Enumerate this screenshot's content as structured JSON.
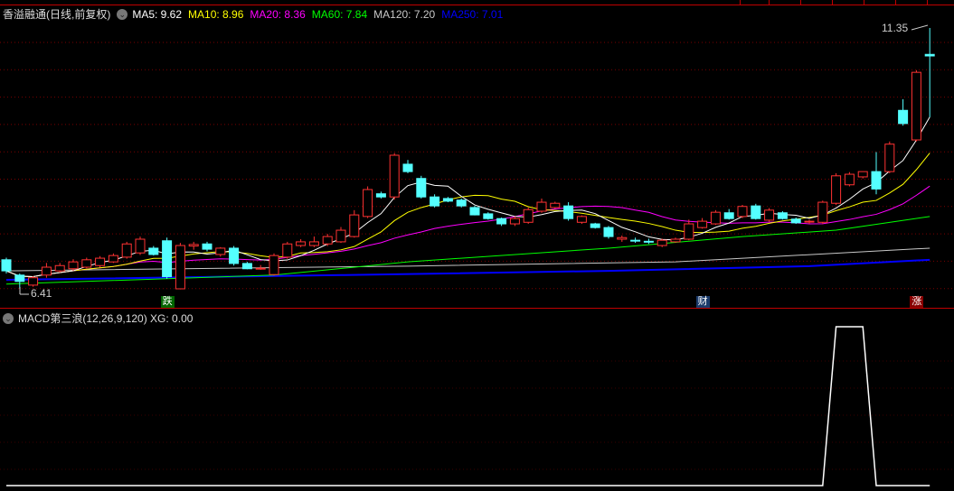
{
  "header": {
    "title": "香溢融通(日线,前复权)",
    "ma": [
      {
        "label": "MA5: 9.62",
        "color": "#ffffff"
      },
      {
        "label": "MA10: 8.96",
        "color": "#ffff00"
      },
      {
        "label": "MA20: 8.36",
        "color": "#ff00ff"
      },
      {
        "label": "MA60: 7.84",
        "color": "#00ff00"
      },
      {
        "label": "MA120: 7.20",
        "color": "#c8c8c8"
      },
      {
        "label": "MA250: 7.01",
        "color": "#0000ff"
      }
    ]
  },
  "annotations": {
    "high_label": "11.35",
    "low_label": "6.41",
    "high_price": 11.35,
    "low_price": 6.41
  },
  "markers": [
    {
      "text": "跌",
      "index": 12,
      "bg": "#006600"
    },
    {
      "text": "财",
      "index": 52,
      "bg": "#1a3a6a"
    },
    {
      "text": "涨",
      "index": 68,
      "bg": "#880000"
    }
  ],
  "indicator": {
    "title": "MACD第三浪(12,26,9,120) XG: 0.00"
  },
  "colors": {
    "up": "#ff3232",
    "down": "#54ffff",
    "grid": "#7a0000"
  },
  "chart_data": {
    "type": "candlestick",
    "ohlc": [
      [
        6.96,
        7.0,
        6.7,
        6.75
      ],
      [
        6.67,
        6.7,
        6.41,
        6.55
      ],
      [
        6.48,
        6.65,
        6.45,
        6.62
      ],
      [
        6.67,
        6.9,
        6.62,
        6.82
      ],
      [
        6.75,
        6.9,
        6.72,
        6.85
      ],
      [
        6.79,
        6.97,
        6.75,
        6.92
      ],
      [
        6.82,
        7.0,
        6.8,
        6.96
      ],
      [
        6.85,
        7.03,
        6.82,
        6.99
      ],
      [
        6.92,
        7.08,
        6.9,
        7.04
      ],
      [
        7.01,
        7.3,
        6.98,
        7.26
      ],
      [
        7.09,
        7.4,
        7.05,
        7.35
      ],
      [
        7.18,
        7.22,
        7.04,
        7.06
      ],
      [
        7.32,
        7.38,
        6.6,
        6.64
      ],
      [
        6.41,
        7.28,
        6.4,
        7.23
      ],
      [
        7.22,
        7.3,
        7.15,
        7.25
      ],
      [
        7.26,
        7.3,
        7.12,
        7.16
      ],
      [
        7.06,
        7.2,
        7.02,
        7.18
      ],
      [
        7.18,
        7.22,
        6.85,
        6.89
      ],
      [
        6.89,
        6.92,
        6.78,
        6.79
      ],
      [
        6.8,
        6.86,
        6.77,
        6.8
      ],
      [
        6.68,
        7.08,
        6.66,
        7.04
      ],
      [
        7.01,
        7.3,
        6.98,
        7.26
      ],
      [
        7.23,
        7.35,
        7.2,
        7.3
      ],
      [
        7.23,
        7.4,
        7.2,
        7.3
      ],
      [
        7.26,
        7.45,
        7.22,
        7.4
      ],
      [
        7.3,
        7.58,
        7.28,
        7.52
      ],
      [
        7.4,
        7.9,
        7.38,
        7.81
      ],
      [
        7.78,
        8.35,
        7.75,
        8.29
      ],
      [
        8.21,
        8.25,
        8.12,
        8.15
      ],
      [
        8.15,
        8.98,
        8.1,
        8.94
      ],
      [
        8.77,
        8.85,
        8.6,
        8.63
      ],
      [
        8.5,
        8.55,
        8.12,
        8.15
      ],
      [
        8.15,
        8.2,
        7.95,
        7.98
      ],
      [
        8.12,
        8.15,
        8.05,
        8.07
      ],
      [
        8.09,
        8.12,
        7.95,
        7.98
      ],
      [
        7.95,
        7.98,
        7.8,
        7.81
      ],
      [
        7.83,
        7.86,
        7.72,
        7.74
      ],
      [
        7.74,
        7.76,
        7.6,
        7.64
      ],
      [
        7.64,
        7.78,
        7.6,
        7.74
      ],
      [
        7.67,
        7.95,
        7.64,
        7.91
      ],
      [
        7.88,
        8.12,
        7.85,
        8.05
      ],
      [
        7.95,
        8.06,
        7.93,
        8.03
      ],
      [
        7.98,
        8.05,
        7.7,
        7.74
      ],
      [
        7.67,
        7.8,
        7.64,
        7.78
      ],
      [
        7.64,
        7.66,
        7.55,
        7.57
      ],
      [
        7.57,
        7.6,
        7.36,
        7.4
      ],
      [
        7.35,
        7.42,
        7.3,
        7.38
      ],
      [
        7.33,
        7.38,
        7.28,
        7.32
      ],
      [
        7.31,
        7.36,
        7.26,
        7.3
      ],
      [
        7.23,
        7.36,
        7.2,
        7.33
      ],
      [
        7.3,
        7.38,
        7.28,
        7.35
      ],
      [
        7.35,
        7.72,
        7.33,
        7.64
      ],
      [
        7.57,
        7.75,
        7.55,
        7.69
      ],
      [
        7.64,
        7.9,
        7.62,
        7.86
      ],
      [
        7.85,
        7.92,
        7.72,
        7.74
      ],
      [
        7.78,
        8.0,
        7.75,
        7.97
      ],
      [
        7.98,
        8.02,
        7.72,
        7.74
      ],
      [
        7.71,
        7.94,
        7.68,
        7.9
      ],
      [
        7.85,
        7.88,
        7.72,
        7.74
      ],
      [
        7.73,
        7.76,
        7.64,
        7.66
      ],
      [
        7.68,
        7.72,
        7.64,
        7.69
      ],
      [
        7.67,
        8.08,
        7.64,
        8.05
      ],
      [
        8.03,
        8.6,
        8.0,
        8.55
      ],
      [
        8.38,
        8.62,
        8.35,
        8.58
      ],
      [
        8.53,
        8.62,
        8.5,
        8.63
      ],
      [
        8.63,
        9.0,
        8.2,
        8.3
      ],
      [
        8.63,
        9.2,
        8.6,
        9.15
      ],
      [
        9.79,
        10.0,
        9.5,
        9.54
      ],
      [
        9.23,
        10.55,
        9.2,
        10.51
      ],
      [
        10.85,
        11.35,
        9.66,
        10.82
      ]
    ],
    "ma60": [
      [
        0,
        6.5
      ],
      [
        20,
        6.67
      ],
      [
        30,
        6.92
      ],
      [
        45,
        7.18
      ],
      [
        55,
        7.4
      ],
      [
        62,
        7.52
      ],
      [
        69,
        7.78
      ]
    ],
    "ma120": [
      [
        0,
        6.75
      ],
      [
        30,
        6.84
      ],
      [
        50,
        6.92
      ],
      [
        69,
        7.18
      ]
    ],
    "ma250": [
      [
        0,
        6.58
      ],
      [
        25,
        6.67
      ],
      [
        45,
        6.75
      ],
      [
        60,
        6.84
      ],
      [
        69,
        6.96
      ]
    ],
    "xg": [
      0,
      0,
      0,
      0,
      0,
      0,
      0,
      0,
      0,
      0,
      0,
      0,
      0,
      0,
      0,
      0,
      0,
      0,
      0,
      0,
      0,
      0,
      0,
      0,
      0,
      0,
      0,
      0,
      0,
      0,
      0,
      0,
      0,
      0,
      0,
      0,
      0,
      0,
      0,
      0,
      0,
      0,
      0,
      0,
      0,
      0,
      0,
      0,
      0,
      0,
      0,
      0,
      0,
      0,
      0,
      0,
      0,
      0,
      0,
      0,
      0,
      0,
      1,
      1,
      1,
      0,
      0,
      0,
      0,
      0
    ]
  }
}
